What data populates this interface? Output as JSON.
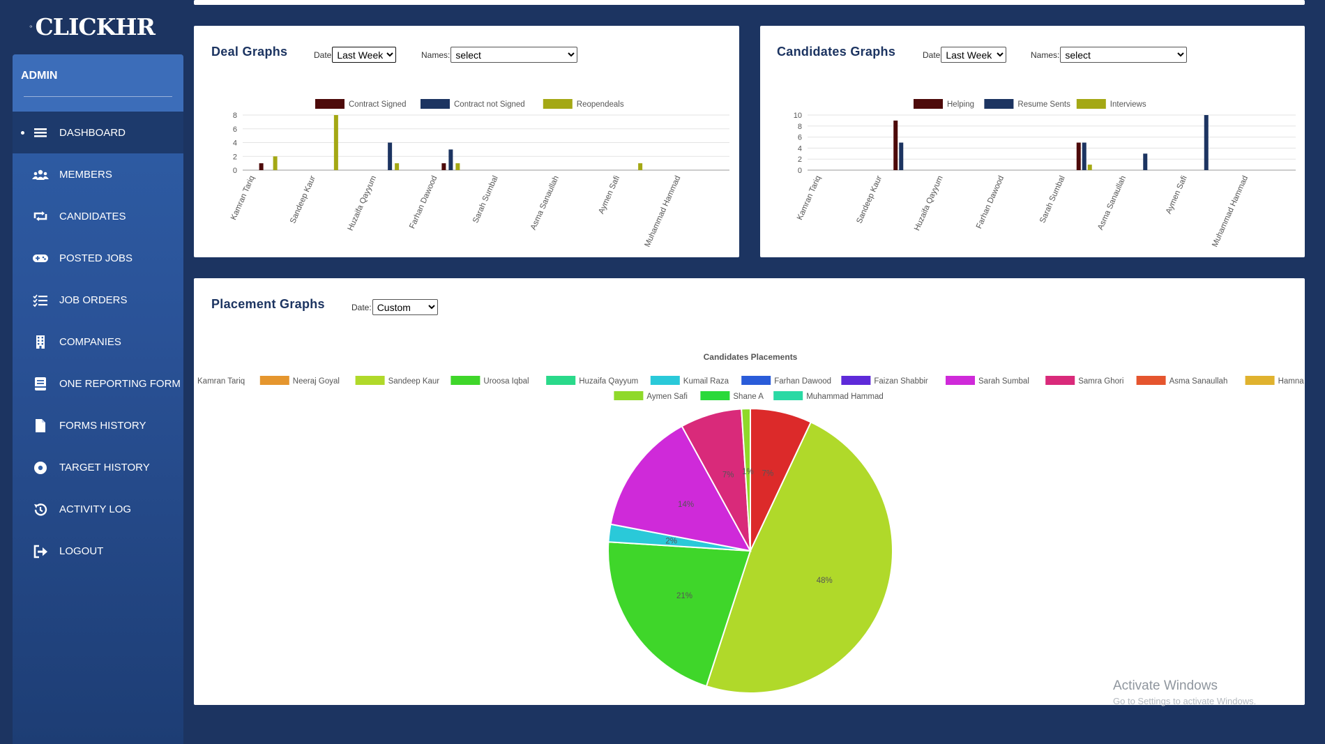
{
  "brand": {
    "name": "CLICKHR"
  },
  "sidebar": {
    "header": "ADMIN",
    "items": [
      {
        "label": "DASHBOARD",
        "icon": "menu-icon",
        "active": true
      },
      {
        "label": "MEMBERS",
        "icon": "users-icon"
      },
      {
        "label": "CANDIDATES",
        "icon": "retweet-icon"
      },
      {
        "label": "POSTED JOBS",
        "icon": "gamepad-icon"
      },
      {
        "label": "JOB ORDERS",
        "icon": "tasks-icon"
      },
      {
        "label": "COMPANIES",
        "icon": "building-icon"
      },
      {
        "label": "ONE REPORTING FORM",
        "icon": "form-icon"
      },
      {
        "label": "FORMS HISTORY",
        "icon": "file-icon"
      },
      {
        "label": "TARGET HISTORY",
        "icon": "target-icon"
      },
      {
        "label": "ACTIVITY LOG",
        "icon": "history-icon"
      },
      {
        "label": "LOGOUT",
        "icon": "logout-icon"
      }
    ]
  },
  "deal": {
    "title": "Deal Graphs",
    "date_label": "Date",
    "date_value": "Last Week",
    "names_label": "Names:",
    "names_value": "select"
  },
  "candidates": {
    "title": "Candidates Graphs",
    "date_label": "Date",
    "date_value": "Last Week",
    "names_label": "Names:",
    "names_value": "select"
  },
  "placement": {
    "title": "Placement Graphs",
    "date_label": "Date:",
    "date_value": "Custom"
  },
  "watermark": {
    "line1": "Activate Windows",
    "line2": "Go to Settings to activate Windows."
  },
  "chart_data": [
    {
      "type": "bar",
      "categories": [
        "Kamran Tariq",
        "Sandeep Kaur",
        "Huzaifa Qayyum",
        "Farhan Dawood",
        "Sarah  Sumbal",
        "Asma  Sanaullah",
        "Aymen Safi",
        "Muhammad  Hammad"
      ],
      "series": [
        {
          "name": "Contract Signed",
          "color": "#4d0a0a",
          "values": [
            1,
            0,
            0,
            1,
            0,
            0,
            0,
            0
          ]
        },
        {
          "name": "Contract not Signed",
          "color": "#1c3461",
          "values": [
            0,
            0,
            4,
            3,
            0,
            0,
            0,
            0
          ]
        },
        {
          "name": "Reopendeals",
          "color": "#a4a814",
          "values": [
            2,
            8,
            1,
            1,
            0,
            0,
            1,
            0
          ]
        }
      ],
      "ylim": [
        0,
        8
      ],
      "yticks": [
        0,
        2,
        4,
        6,
        8
      ],
      "legend": "top",
      "grid": true
    },
    {
      "type": "bar",
      "categories": [
        "Kamran Tariq",
        "Sandeep Kaur",
        "Huzaifa Qayyum",
        "Farhan Dawood",
        "Sarah  Sumbal",
        "Asma  Sanaullah",
        "Aymen Safi",
        "Muhammad  Hammad"
      ],
      "series": [
        {
          "name": "Helping",
          "color": "#4d0a0a",
          "values": [
            0,
            9,
            0,
            0,
            5,
            0,
            0,
            0
          ]
        },
        {
          "name": "Resume Sents",
          "color": "#1c3461",
          "values": [
            0,
            5,
            0,
            0,
            5,
            3,
            10,
            0
          ]
        },
        {
          "name": "Interviews",
          "color": "#a4a814",
          "values": [
            0,
            0,
            0,
            0,
            1,
            0,
            0,
            0
          ]
        }
      ],
      "ylim": [
        0,
        10
      ],
      "yticks": [
        0,
        2,
        4,
        6,
        8,
        10
      ],
      "legend": "top",
      "grid": true
    },
    {
      "type": "pie",
      "title": "Candidates Placements",
      "legend": "top",
      "categories": [
        "Kamran Tariq",
        "Neeraj Goyal",
        "Sandeep Kaur",
        "Uroosa Iqbal",
        "Huzaifa Qayyum",
        "Kumail Raza",
        "Farhan Dawood",
        "Faizan Shabbir",
        "Sarah  Sumbal",
        "Samra Ghori",
        "Asma  Sanaullah",
        "Hamna Baber",
        "Aymen Safi",
        "Shane A",
        "Muhammad  Hammad"
      ],
      "colors": [
        "#dc2a2a",
        "#e5962e",
        "#b0d92a",
        "#3fd62a",
        "#2ad98a",
        "#2ac9d9",
        "#2a5cd9",
        "#5e2ad9",
        "#cf2ad9",
        "#d92a7a",
        "#e5552e",
        "#e0b22e",
        "#8fd92a",
        "#2ad93a",
        "#2ad9a4"
      ],
      "values": [
        7,
        0,
        48,
        21,
        0,
        2,
        0,
        0,
        14,
        7,
        0,
        0,
        1,
        0,
        0
      ],
      "labels": [
        "7%",
        "",
        "48%",
        "21%",
        "",
        "2%",
        "",
        "",
        "14%",
        "7%",
        "",
        "",
        "1%",
        "",
        ""
      ]
    }
  ]
}
